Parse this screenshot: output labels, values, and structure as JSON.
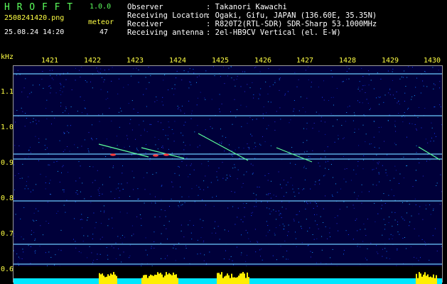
{
  "header": {
    "app_name": "H R O F F T",
    "app_version": "1.0.0",
    "file_name": "2508241420.png",
    "timestamp": "25.08.24 14:20",
    "meteor_label": "meteor",
    "meteor_count": "47",
    "info": [
      {
        "label": "Observer",
        "value": ": Takanori Kawachi"
      },
      {
        "label": "Receiving Location",
        "value": ": Ogaki, Gifu, JAPAN (136.60E, 35.35N)"
      },
      {
        "label": "Receiver",
        "value": ": R820T2(RTL-SDR) SDR-Sharp 53.1000MHz"
      },
      {
        "label": "Receiving antenna",
        "value": ": 2el-HB9CV Vertical (el. E-W)"
      }
    ]
  },
  "spectrogram": {
    "y_unit": "kHz",
    "y_ticks": [
      "1.1",
      "1.0",
      "0.9",
      "0.8",
      "0.7",
      "0.6"
    ],
    "x_ticks": [
      "1421",
      "1422",
      "1423",
      "1424",
      "1425",
      "1426",
      "1427",
      "1428",
      "1429",
      "1430"
    ],
    "colors": {
      "background": "#00003a",
      "carrier": "#6ecbff",
      "meteor": "#ff3b3b",
      "histogram": "#ffee00",
      "floor": "#00e6ff"
    }
  }
}
